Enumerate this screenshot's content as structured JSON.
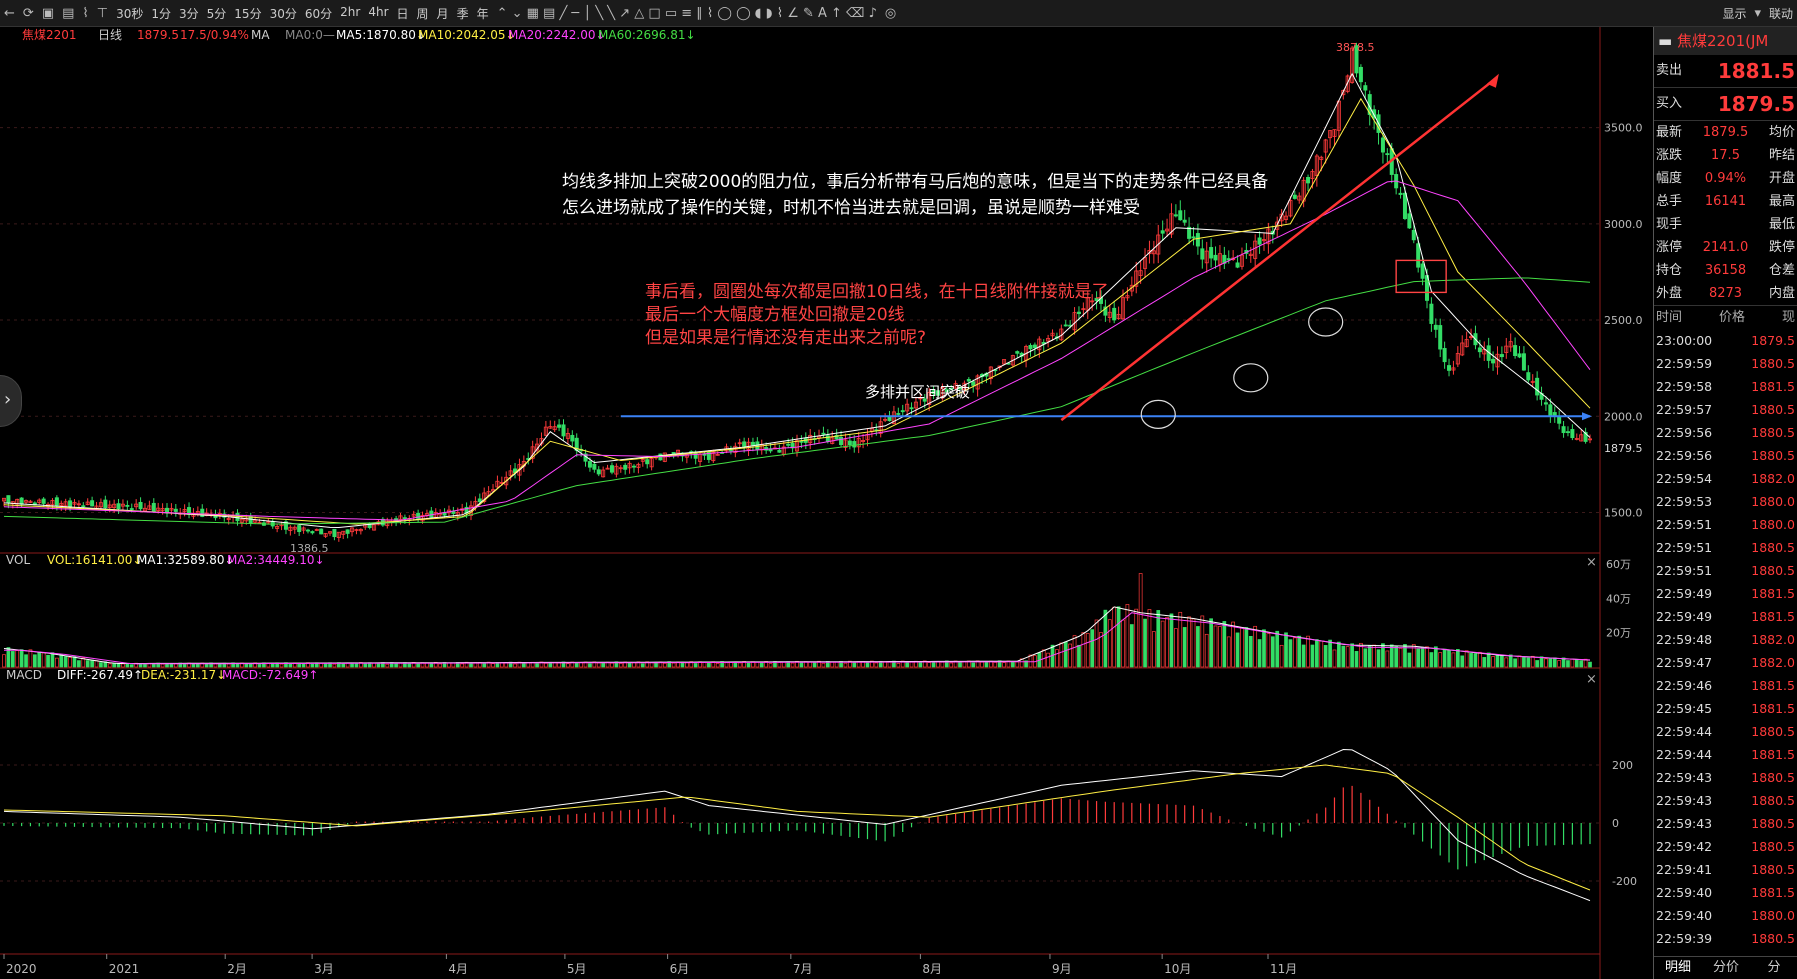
{
  "toolbar": {
    "periods": [
      "30秒",
      "1分",
      "3分",
      "5分",
      "15分",
      "30分",
      "60分",
      "2hr",
      "4hr",
      "日",
      "周",
      "月",
      "季",
      "年"
    ],
    "display_label": "显示",
    "link_label": "联动"
  },
  "header": {
    "symbol": "焦煤2201",
    "period": "日线",
    "price": "1879.5",
    "change": "17.5/0.94%",
    "ma_label": "MA",
    "ma0": "MA0:0—",
    "ma5": "MA5:1870.80↓",
    "ma10": "MA10:2042.05↓",
    "ma20": "MA20:2242.00↓",
    "ma60": "MA60:2696.81↓"
  },
  "vol_header": {
    "name": "VOL",
    "vol": "VOL:16141.00↓",
    "ma1": "MA1:32589.80↓",
    "ma2": "MA2:34449.10↓"
  },
  "macd_header": {
    "name": "MACD",
    "diff": "DIFF:-267.49↑",
    "dea": "DEA:-231.17↓",
    "macd": "MACD:-72.649↑"
  },
  "annotations": {
    "black_line1": "均线多排加上突破2000的阻力位，事后分析带有马后炮的意味，但是当下的走势条件已经具备",
    "black_line2": "怎么进场就成了操作的关键，时机不恰当进去就是回调，虽说是顺势一样难受",
    "red_line1": "事后看，圆圈处每次都是回撤10日线，在十日线附件接就是了",
    "red_line2": "最后一个大幅度方框处回撤是20线",
    "red_line3": "但是如果是行情还没有走出来之前呢?",
    "breakout": "多排并区间突破",
    "high_label": "3878.5",
    "low_label": "1386.5",
    "last_label": "1879.5"
  },
  "chart_data": {
    "type": "candlestick",
    "title": "焦煤2201 日线",
    "price_axis": {
      "ticks": [
        "1500.0",
        "2000.0",
        "2500.0",
        "3000.0",
        "3500.0"
      ],
      "range": [
        1300,
        3950
      ]
    },
    "x_labels": [
      "2020",
      "2021",
      "2月",
      "3月",
      "4月",
      "5月",
      "6月",
      "7月",
      "8月",
      "9月",
      "10月",
      "11月"
    ],
    "horizontal_line": 2000,
    "price_path": [
      [
        0,
        1560
      ],
      [
        30,
        1530
      ],
      [
        50,
        1480
      ],
      [
        65,
        1420
      ],
      [
        75,
        1386.5
      ],
      [
        90,
        1470
      ],
      [
        105,
        1510
      ],
      [
        110,
        1610
      ],
      [
        118,
        1760
      ],
      [
        124,
        1960
      ],
      [
        128,
        1900
      ],
      [
        134,
        1710
      ],
      [
        142,
        1740
      ],
      [
        152,
        1810
      ],
      [
        160,
        1790
      ],
      [
        168,
        1860
      ],
      [
        175,
        1820
      ],
      [
        185,
        1900
      ],
      [
        193,
        1850
      ],
      [
        200,
        1980
      ],
      [
        210,
        2110
      ],
      [
        220,
        2180
      ],
      [
        230,
        2320
      ],
      [
        240,
        2440
      ],
      [
        247,
        2620
      ],
      [
        252,
        2500
      ],
      [
        258,
        2780
      ],
      [
        266,
        3060
      ],
      [
        272,
        2840
      ],
      [
        280,
        2800
      ],
      [
        288,
        2970
      ],
      [
        296,
        3230
      ],
      [
        302,
        3520
      ],
      [
        306,
        3878.5
      ],
      [
        310,
        3600
      ],
      [
        316,
        3200
      ],
      [
        320,
        2900
      ],
      [
        324,
        2500
      ],
      [
        328,
        2220
      ],
      [
        332,
        2420
      ],
      [
        338,
        2280
      ],
      [
        342,
        2380
      ],
      [
        346,
        2200
      ],
      [
        350,
        2050
      ],
      [
        355,
        1900
      ],
      [
        360,
        1879.5
      ]
    ],
    "ma_paths": [
      {
        "name": "MA5",
        "color": "#ffffff",
        "values": [
          [
            0,
            1550
          ],
          [
            50,
            1480
          ],
          [
            75,
            1420
          ],
          [
            105,
            1490
          ],
          [
            118,
            1740
          ],
          [
            124,
            1920
          ],
          [
            134,
            1760
          ],
          [
            168,
            1840
          ],
          [
            200,
            1950
          ],
          [
            240,
            2420
          ],
          [
            266,
            2980
          ],
          [
            288,
            2950
          ],
          [
            306,
            3780
          ],
          [
            316,
            3350
          ],
          [
            324,
            2650
          ],
          [
            336,
            2350
          ],
          [
            350,
            2100
          ],
          [
            360,
            1890
          ]
        ]
      },
      {
        "name": "MA10",
        "color": "#ffee44",
        "values": [
          [
            0,
            1540
          ],
          [
            50,
            1485
          ],
          [
            80,
            1440
          ],
          [
            105,
            1480
          ],
          [
            124,
            1870
          ],
          [
            140,
            1770
          ],
          [
            170,
            1840
          ],
          [
            200,
            1930
          ],
          [
            240,
            2380
          ],
          [
            270,
            2920
          ],
          [
            292,
            3000
          ],
          [
            308,
            3650
          ],
          [
            320,
            3200
          ],
          [
            330,
            2750
          ],
          [
            345,
            2400
          ],
          [
            360,
            2042
          ]
        ]
      },
      {
        "name": "MA20",
        "color": "#ff44ff",
        "values": [
          [
            0,
            1530
          ],
          [
            60,
            1480
          ],
          [
            90,
            1460
          ],
          [
            115,
            1560
          ],
          [
            130,
            1800
          ],
          [
            150,
            1790
          ],
          [
            180,
            1840
          ],
          [
            210,
            1960
          ],
          [
            240,
            2300
          ],
          [
            270,
            2720
          ],
          [
            300,
            3050
          ],
          [
            315,
            3230
          ],
          [
            330,
            3120
          ],
          [
            345,
            2700
          ],
          [
            360,
            2242
          ]
        ]
      },
      {
        "name": "MA60",
        "color": "#44dd44",
        "values": [
          [
            0,
            1480
          ],
          [
            60,
            1440
          ],
          [
            100,
            1450
          ],
          [
            130,
            1640
          ],
          [
            170,
            1780
          ],
          [
            210,
            1900
          ],
          [
            240,
            2050
          ],
          [
            270,
            2330
          ],
          [
            300,
            2600
          ],
          [
            320,
            2700
          ],
          [
            345,
            2720
          ],
          [
            360,
            2696.81
          ]
        ]
      }
    ],
    "volume_axis": {
      "ticks": [
        "20万",
        "40万",
        "60万"
      ]
    },
    "volume_profile": [
      [
        0,
        0.16
      ],
      [
        10,
        0.12
      ],
      [
        25,
        0.03
      ],
      [
        230,
        0.05
      ],
      [
        245,
        0.28
      ],
      [
        252,
        0.52
      ],
      [
        258,
        0.47
      ],
      [
        270,
        0.42
      ],
      [
        290,
        0.28
      ],
      [
        305,
        0.19
      ],
      [
        320,
        0.18
      ],
      [
        340,
        0.1
      ],
      [
        360,
        0.06
      ]
    ],
    "volume_peak": [
      258,
      0.85
    ],
    "macd_axis": {
      "ticks": [
        "200",
        "0",
        "-200"
      ]
    },
    "macd_diff": [
      [
        0,
        40
      ],
      [
        40,
        20
      ],
      [
        70,
        -20
      ],
      [
        110,
        30
      ],
      [
        150,
        110
      ],
      [
        160,
        60
      ],
      [
        200,
        -5
      ],
      [
        240,
        130
      ],
      [
        270,
        180
      ],
      [
        290,
        160
      ],
      [
        305,
        260
      ],
      [
        315,
        180
      ],
      [
        330,
        -60
      ],
      [
        345,
        -180
      ],
      [
        360,
        -267.49
      ]
    ],
    "macd_dea": [
      [
        0,
        45
      ],
      [
        50,
        25
      ],
      [
        80,
        -10
      ],
      [
        120,
        40
      ],
      [
        155,
        90
      ],
      [
        180,
        40
      ],
      [
        210,
        20
      ],
      [
        250,
        110
      ],
      [
        280,
        170
      ],
      [
        300,
        200
      ],
      [
        315,
        170
      ],
      [
        330,
        20
      ],
      [
        345,
        -140
      ],
      [
        360,
        -231.17
      ]
    ]
  },
  "right_panel": {
    "title": "焦煤2201(JM",
    "sell_label": "卖出",
    "sell_price": "1881.5",
    "buy_label": "买入",
    "buy_price": "1879.5",
    "stats": [
      {
        "k": "最新",
        "v": "1879.5",
        "k2": "均价"
      },
      {
        "k": "涨跌",
        "v": "17.5",
        "k2": "昨结"
      },
      {
        "k": "幅度",
        "v": "0.94%",
        "k2": "开盘"
      },
      {
        "k": "总手",
        "v": "16141",
        "k2": "最高"
      },
      {
        "k": "现手",
        "v": "",
        "k2": "最低"
      },
      {
        "k": "涨停",
        "v": "2141.0",
        "k2": "跌停"
      },
      {
        "k": "持仓",
        "v": "36158",
        "k2": "仓差"
      },
      {
        "k": "外盘",
        "v": "8273",
        "k2": "内盘"
      }
    ],
    "tick_header": [
      "时间",
      "价格",
      "现"
    ],
    "ticks": [
      [
        "23:00:00",
        "1879.5"
      ],
      [
        "22:59:59",
        "1880.5"
      ],
      [
        "22:59:58",
        "1881.5"
      ],
      [
        "22:59:57",
        "1880.5"
      ],
      [
        "22:59:56",
        "1880.5"
      ],
      [
        "22:59:56",
        "1880.5"
      ],
      [
        "22:59:54",
        "1882.0"
      ],
      [
        "22:59:53",
        "1880.0"
      ],
      [
        "22:59:51",
        "1880.0"
      ],
      [
        "22:59:51",
        "1880.5"
      ],
      [
        "22:59:51",
        "1880.5"
      ],
      [
        "22:59:49",
        "1881.5"
      ],
      [
        "22:59:49",
        "1881.5"
      ],
      [
        "22:59:48",
        "1882.0"
      ],
      [
        "22:59:47",
        "1882.0"
      ],
      [
        "22:59:46",
        "1881.5"
      ],
      [
        "22:59:45",
        "1881.5"
      ],
      [
        "22:59:44",
        "1880.5"
      ],
      [
        "22:59:44",
        "1881.5"
      ],
      [
        "22:59:43",
        "1880.5"
      ],
      [
        "22:59:43",
        "1880.5"
      ],
      [
        "22:59:43",
        "1880.5"
      ],
      [
        "22:59:42",
        "1880.5"
      ],
      [
        "22:59:41",
        "1880.5"
      ],
      [
        "22:59:40",
        "1881.5"
      ],
      [
        "22:59:40",
        "1880.0"
      ],
      [
        "22:59:39",
        "1880.5"
      ]
    ],
    "tabs": [
      "明细",
      "分价",
      "分"
    ]
  }
}
